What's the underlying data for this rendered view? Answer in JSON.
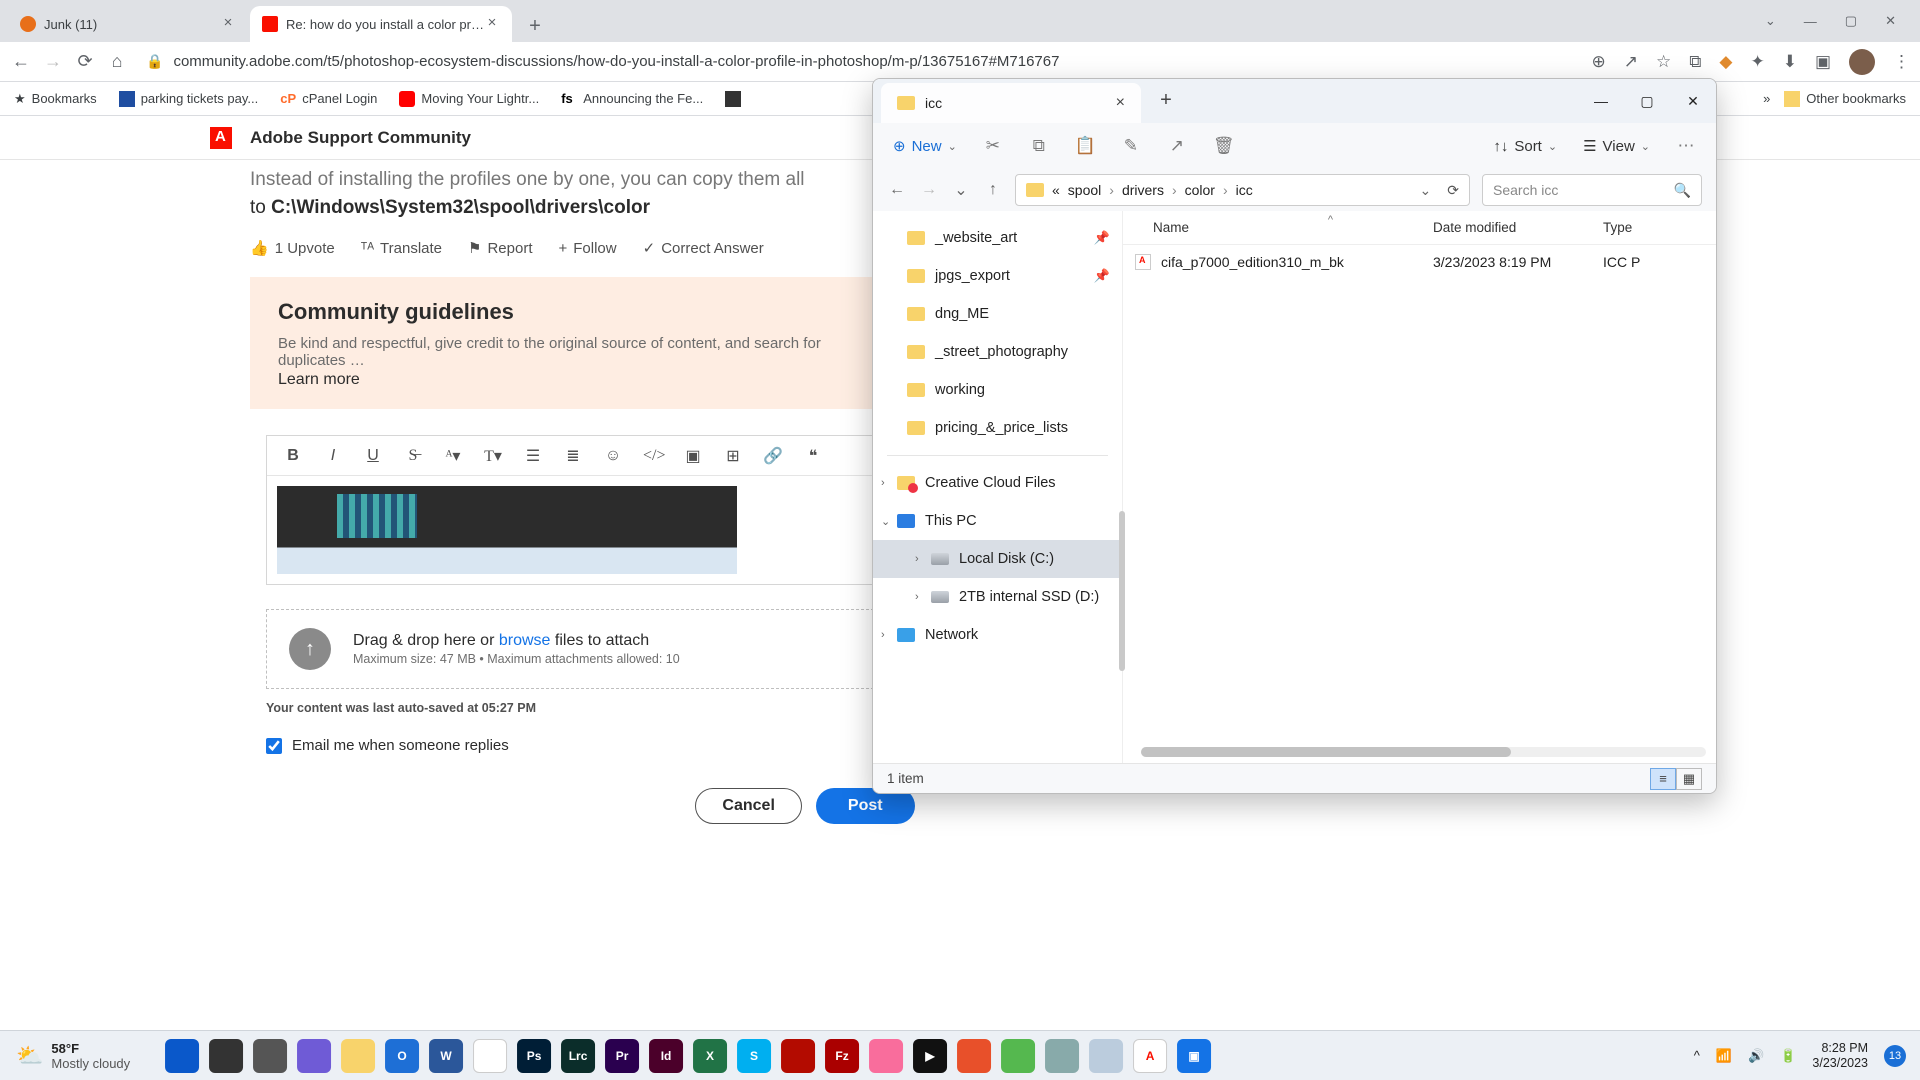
{
  "chrome": {
    "tabs": [
      {
        "title": "Junk (11)",
        "favicon": "#e86f1a"
      },
      {
        "title": "Re: how do you install a color pr…",
        "favicon": "#fa0f00"
      }
    ],
    "url": "community.adobe.com/t5/photoshop-ecosystem-discussions/how-do-you-install-a-color-profile-in-photoshop/m-p/13675167#M716767",
    "bookmarks": {
      "main": "Bookmarks",
      "items": [
        "parking tickets pay...",
        "cPanel Login",
        "Moving Your Lightr...",
        "Announcing the Fe..."
      ],
      "other": "Other bookmarks"
    },
    "win": {
      "min": "—",
      "max": "▢",
      "close": "✕",
      "drop": "⌄"
    }
  },
  "adobe": {
    "brand": "Adobe Support Community",
    "post_cut": "Instead of installing the profiles one by one, you can copy them all",
    "post_rest_a": "to ",
    "post_rest_b": "C:\\Windows\\System32\\spool\\drivers\\color",
    "actions": {
      "upvote": "1 Upvote",
      "translate": "Translate",
      "report": "Report",
      "follow": "Follow",
      "correct": "Correct Answer"
    },
    "guidelines": {
      "title": "Community guidelines",
      "body": "Be kind and respectful, give credit to the original source of content, and search for duplicates …",
      "link": "Learn more"
    },
    "dropzone": {
      "line1a": "Drag & drop here or ",
      "browse": "browse",
      "line1b": " files to attach",
      "line2": "Maximum size: 47 MB • Maximum attachments allowed: 10"
    },
    "autosave": "Your content was last auto-saved at 05:27 PM",
    "emailme": "Email me when someone replies",
    "cancel": "Cancel",
    "post": "Post"
  },
  "explorer": {
    "tab": "icc",
    "toolbar": {
      "new": "New",
      "sort": "Sort",
      "view": "View"
    },
    "crumbs": [
      "«",
      "spool",
      "drivers",
      "color",
      "icc"
    ],
    "search_placeholder": "Search icc",
    "quick": [
      "_website_art",
      "jpgs_export",
      "dng_ME",
      "_street_photography",
      "working",
      "pricing_&_price_lists"
    ],
    "pinned": [
      true,
      true,
      false,
      false,
      false,
      false
    ],
    "tree": {
      "cc": "Creative Cloud Files",
      "pc": "This PC",
      "c": "Local Disk (C:)",
      "d": "2TB internal SSD (D:)",
      "net": "Network"
    },
    "columns": {
      "name": "Name",
      "date": "Date modified",
      "type": "Type"
    },
    "rows": [
      {
        "name": "cifa_p7000_edition310_m_bk",
        "date": "3/23/2023 8:19 PM",
        "type": "ICC P"
      }
    ],
    "status": "1 item"
  },
  "taskbar": {
    "weather_temp": "58°F",
    "weather_desc": "Mostly cloudy",
    "apps": [
      {
        "bg": "#0a58ca",
        "t": ""
      },
      {
        "bg": "#333",
        "t": ""
      },
      {
        "bg": "#555",
        "t": ""
      },
      {
        "bg": "#6f5bd6",
        "t": ""
      },
      {
        "bg": "#f8d36b",
        "t": ""
      },
      {
        "bg": "#1e6fd6",
        "t": "O"
      },
      {
        "bg": "#2b579a",
        "t": "W"
      },
      {
        "bg": "#fff",
        "t": ""
      },
      {
        "bg": "#001e36",
        "t": "Ps"
      },
      {
        "bg": "#0b2d2a",
        "t": "Lrc"
      },
      {
        "bg": "#2a004f",
        "t": "Pr"
      },
      {
        "bg": "#4b002a",
        "t": "Id"
      },
      {
        "bg": "#217346",
        "t": "X"
      },
      {
        "bg": "#00aff0",
        "t": "S"
      },
      {
        "bg": "#b30b00",
        "t": ""
      },
      {
        "bg": "#a00",
        "t": "Fz"
      },
      {
        "bg": "#f96d9c",
        "t": ""
      },
      {
        "bg": "#111",
        "t": "▶"
      },
      {
        "bg": "#e8502a",
        "t": ""
      },
      {
        "bg": "#55b84f",
        "t": ""
      },
      {
        "bg": "#8aa",
        "t": ""
      },
      {
        "bg": "#bcd",
        "t": ""
      },
      {
        "bg": "#fff",
        "t": "A"
      },
      {
        "bg": "#1473e6",
        "t": "▣"
      }
    ],
    "time": "8:28 PM",
    "date": "3/23/2023",
    "notif": "13"
  }
}
